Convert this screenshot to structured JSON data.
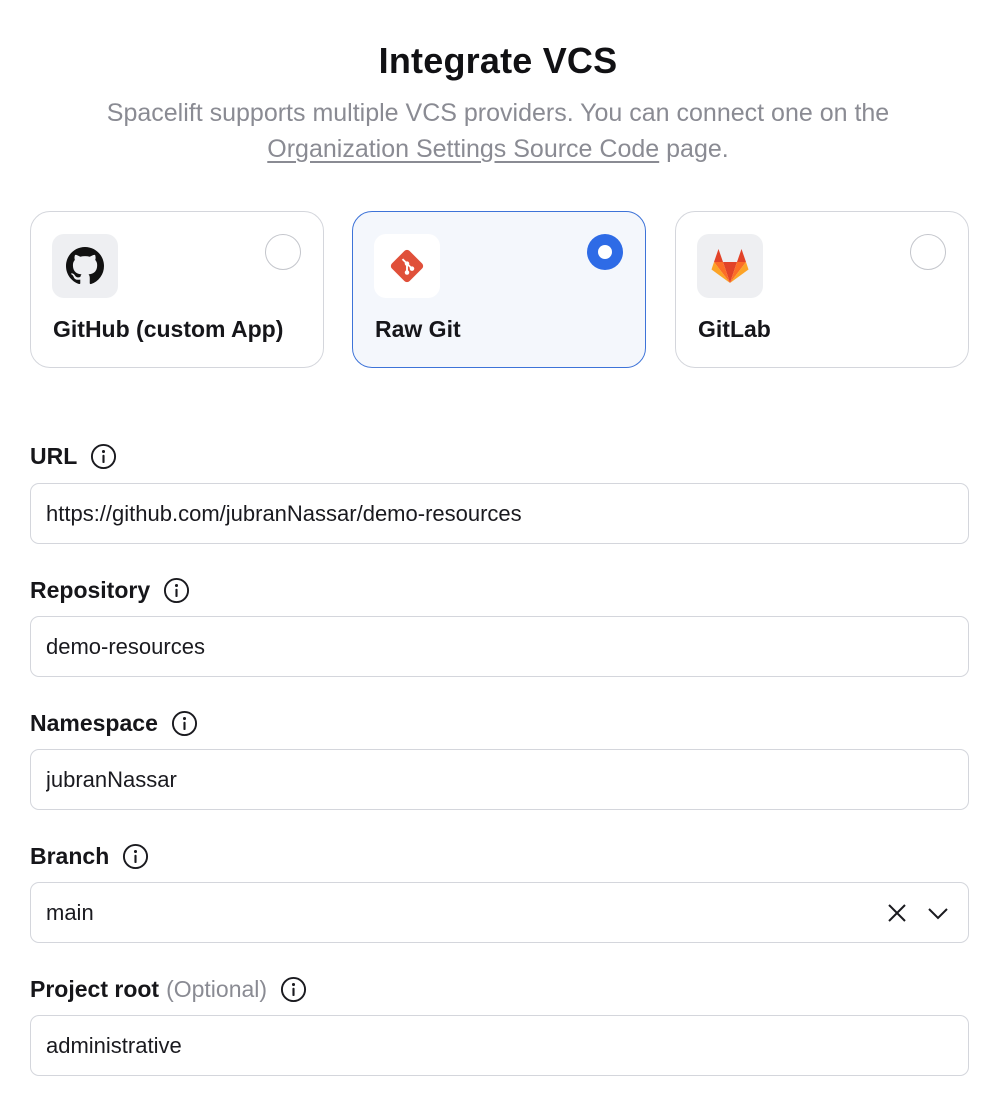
{
  "header": {
    "title": "Integrate VCS",
    "subtitle_before": "Spacelift supports multiple VCS providers. You can connect one on the ",
    "subtitle_link": "Organization Settings Source Code",
    "subtitle_after": " page."
  },
  "providers": [
    {
      "label": "GitHub (custom App)",
      "icon": "github-icon",
      "selected": false
    },
    {
      "label": "Raw Git",
      "icon": "git-icon",
      "selected": true
    },
    {
      "label": "GitLab",
      "icon": "gitlab-icon",
      "selected": false
    }
  ],
  "fields": {
    "url": {
      "label": "URL",
      "value": "https://github.com/jubranNassar/demo-resources"
    },
    "repository": {
      "label": "Repository",
      "value": "demo-resources"
    },
    "namespace": {
      "label": "Namespace",
      "value": "jubranNassar"
    },
    "branch": {
      "label": "Branch",
      "value": "main"
    },
    "project_root": {
      "label": "Project root",
      "optional": "(Optional)",
      "value": "administrative"
    }
  },
  "colors": {
    "accent": "#2e6be6",
    "selected_border": "#3d73d8",
    "git_orange": "#e0503a",
    "gitlab_orange": "#e24329",
    "muted_text": "#8a8b93"
  }
}
